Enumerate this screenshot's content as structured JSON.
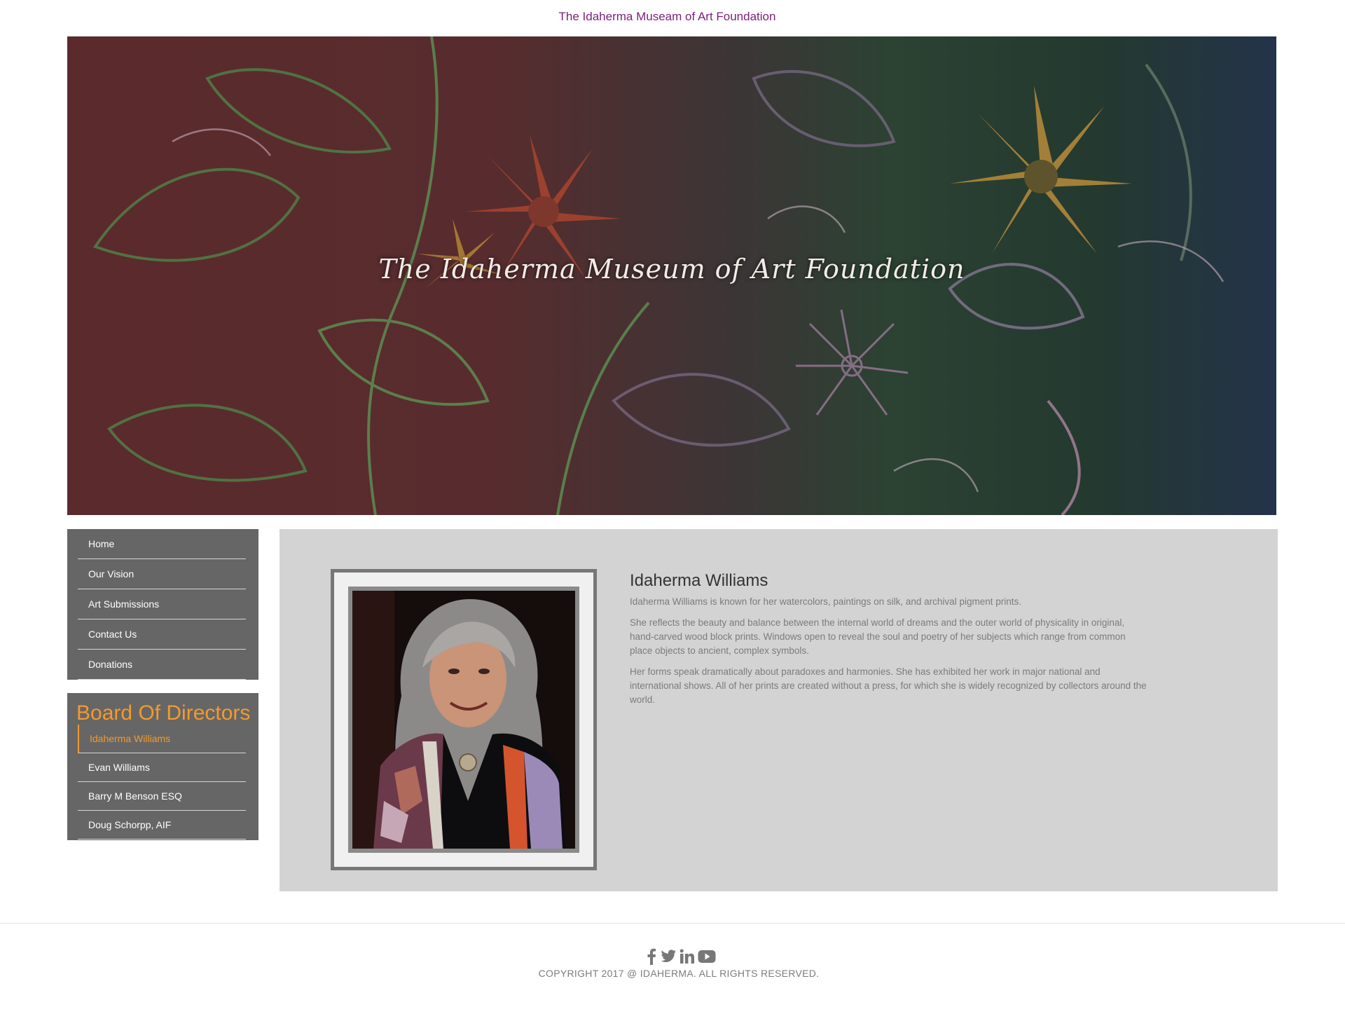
{
  "site": {
    "title": "The Idaherma Museam of Art Foundation"
  },
  "hero": {
    "caption": "The Idaherma Museum of Art Foundation"
  },
  "nav": {
    "items": [
      {
        "label": "Home"
      },
      {
        "label": "Our Vision"
      },
      {
        "label": "Art Submissions"
      },
      {
        "label": "Contact Us"
      },
      {
        "label": "Donations"
      }
    ]
  },
  "board": {
    "title": "Board Of Directors",
    "members": [
      {
        "label": "Idaherma Williams",
        "active": true
      },
      {
        "label": "Evan Williams",
        "active": false
      },
      {
        "label": "Barry M Benson ESQ",
        "active": false
      },
      {
        "label": "Doug Schorpp, AIF",
        "active": false
      }
    ]
  },
  "profile": {
    "name": "Idaherma Williams",
    "paragraphs": [
      "Idaherma Williams is known for her watercolors, paintings on silk, and archival pigment prints.",
      "She reflects the beauty and balance between the internal world of dreams and the outer world of physicality in original, hand-carved wood block prints. Windows open to reveal the soul and poetry of her subjects which range from common place objects to ancient, complex symbols.",
      "Her forms speak dramatically about paradoxes and harmonies. She has exhibited her work in major national and international shows. All of her prints are created without a press, for which she is widely recognized by collectors around the world."
    ]
  },
  "footer": {
    "social_icons": [
      "facebook-icon",
      "twitter-icon",
      "linkedin-icon",
      "youtube-icon"
    ],
    "copyright": "COPYRIGHT 2017 @ IDAHERMA. ALL RIGHTS RESERVED."
  },
  "colors": {
    "title_purple": "#7a1f7a",
    "accent_orange": "#f39a2b",
    "nav_bg": "#666666",
    "content_bg": "#d3d3d3"
  }
}
